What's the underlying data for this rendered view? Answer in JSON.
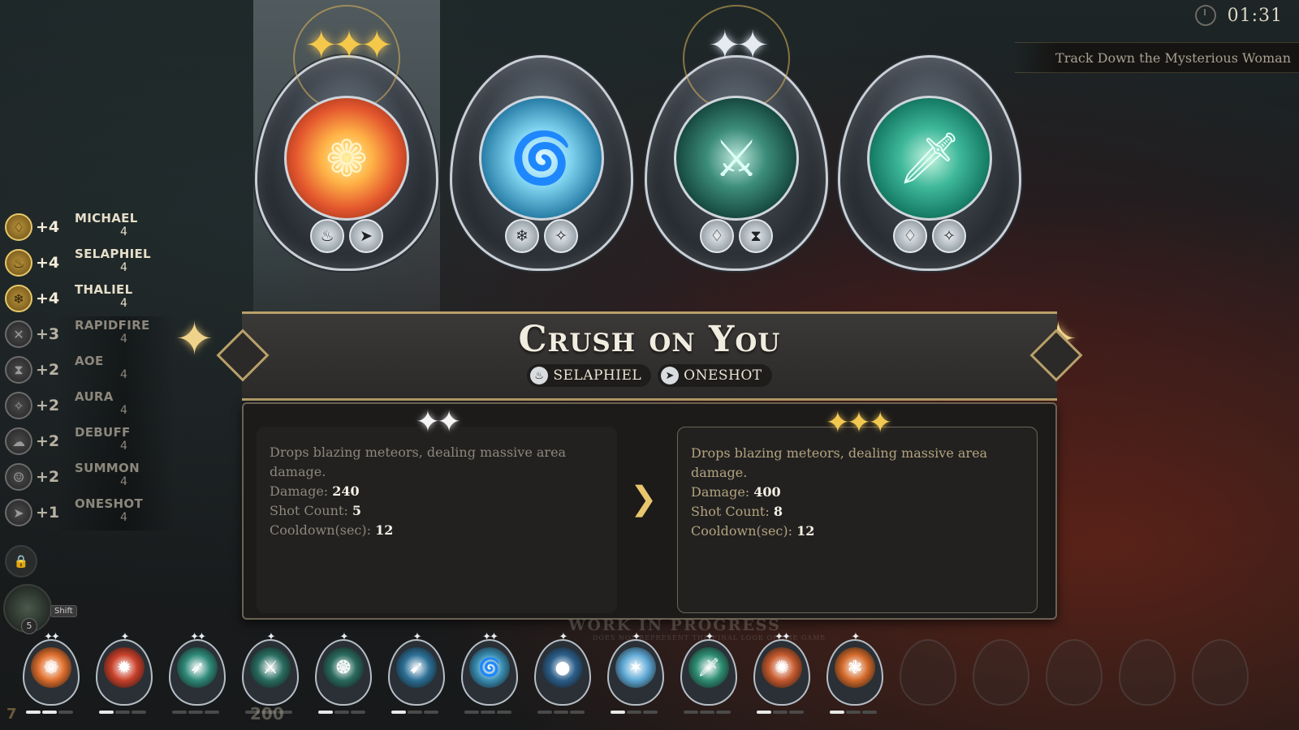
{
  "hud": {
    "timer": "01:31",
    "quest": "Track Down the Mysterious Woman"
  },
  "synergies": [
    {
      "icon": "♢",
      "level": "+4",
      "name": "MICHAEL",
      "count": "4",
      "active": true,
      "icon_name": "sword-icon"
    },
    {
      "icon": "♨",
      "level": "+4",
      "name": "SELAPHIEL",
      "count": "4",
      "active": true,
      "icon_name": "flame-icon"
    },
    {
      "icon": "❄",
      "level": "+4",
      "name": "THALIEL",
      "count": "4",
      "active": true,
      "icon_name": "snowflake-icon"
    },
    {
      "icon": "✕",
      "level": "+3",
      "name": "RAPIDFIRE",
      "count": "4",
      "active": false,
      "icon_name": "rapidfire-icon"
    },
    {
      "icon": "⧗",
      "level": "+2",
      "name": "AOE",
      "count": "4",
      "active": false,
      "icon_name": "hourglass-icon"
    },
    {
      "icon": "✧",
      "level": "+2",
      "name": "AURA",
      "count": "4",
      "active": false,
      "icon_name": "aura-icon"
    },
    {
      "icon": "☁",
      "level": "+2",
      "name": "DEBUFF",
      "count": "4",
      "active": false,
      "icon_name": "debuff-icon"
    },
    {
      "icon": "☺",
      "level": "+2",
      "name": "SUMMON",
      "count": "4",
      "active": false,
      "icon_name": "summon-icon"
    },
    {
      "icon": "➤",
      "level": "+1",
      "name": "ONESHOT",
      "count": "4",
      "active": false,
      "icon_name": "oneshot-icon"
    }
  ],
  "character": {
    "number": "5",
    "shift_key": "Shift",
    "lock_icon": "lock-icon"
  },
  "choices": [
    {
      "name": "crush-on-you",
      "orb_icon": "❁",
      "orb_class": "fire",
      "stars": "✦✦✦",
      "star_color": "gold",
      "tags": [
        "♨",
        "➤"
      ],
      "tag_names": [
        "selaphiel-tag-icon",
        "oneshot-tag-icon"
      ],
      "selected": true
    },
    {
      "name": "tornado",
      "orb_icon": "🌀",
      "orb_class": "ice",
      "stars": "",
      "star_color": "",
      "tags": [
        "❄",
        "✧"
      ],
      "tag_names": [
        "thaliel-tag-icon",
        "aura-tag-icon"
      ],
      "selected": false
    },
    {
      "name": "blade-rain",
      "orb_icon": "⚔",
      "orb_class": "blade",
      "stars": "✦✦",
      "star_color": "silver",
      "tags": [
        "♢",
        "⧗"
      ],
      "tag_names": [
        "michael-tag-icon",
        "aoe-tag-icon"
      ],
      "selected": false
    },
    {
      "name": "sword-wind",
      "orb_icon": "🗡",
      "orb_class": "wind",
      "stars": "",
      "star_color": "",
      "tags": [
        "♢",
        "✧"
      ],
      "tag_names": [
        "michael-tag-icon",
        "aura-tag-icon"
      ],
      "selected": false
    }
  ],
  "detail": {
    "title": "Crush on You",
    "tags": [
      {
        "icon": "♨",
        "label": "SELAPHIEL"
      },
      {
        "icon": "➤",
        "label": "ONESHOT"
      }
    ],
    "before": {
      "stars": "✦✦",
      "description": "Drops blazing meteors, dealing massive area damage.",
      "damage_label": "Damage:",
      "damage": "240",
      "shot_label": "Shot Count:",
      "shot": "5",
      "cooldown_label": "Cooldown(sec):",
      "cooldown": "12"
    },
    "after": {
      "stars": "✦✦✦",
      "description": "Drops blazing meteors, dealing massive area damage.",
      "damage_label": "Damage:",
      "damage": "400",
      "shot_label": "Shot Count:",
      "shot": "8",
      "cooldown_label": "Cooldown(sec):",
      "cooldown": "12"
    }
  },
  "watermark": {
    "title": "WORK IN PROGRESS",
    "subtitle": "DOES NOT REPRESENT THE FINAL LOOK OF THE GAME"
  },
  "inventory": [
    {
      "icon": "❁",
      "color": "#e0702e",
      "stars": "✦✦",
      "pips": 2
    },
    {
      "icon": "✹",
      "color": "#c9402a",
      "stars": "✦",
      "pips": 1
    },
    {
      "icon": "➶",
      "color": "#2f8a7a",
      "stars": "✦✦",
      "pips": 0
    },
    {
      "icon": "⚔",
      "color": "#2a6e62",
      "stars": "✦",
      "pips": 0
    },
    {
      "icon": "❂",
      "color": "#2a6a5e",
      "stars": "✦",
      "pips": 1
    },
    {
      "icon": "➹",
      "color": "#2c6f96",
      "stars": "✦",
      "pips": 1
    },
    {
      "icon": "🌀",
      "color": "#3a8fb5",
      "stars": "✦✦",
      "pips": 0
    },
    {
      "icon": "●",
      "color": "#2c5f8a",
      "stars": "✦",
      "pips": 0
    },
    {
      "icon": "✶",
      "color": "#5fa9d6",
      "stars": "✦",
      "pips": 1
    },
    {
      "icon": "🗡",
      "color": "#2f8f74",
      "stars": "✦",
      "pips": 0
    },
    {
      "icon": "✺",
      "color": "#c65a2e",
      "stars": "✦✦",
      "pips": 1
    },
    {
      "icon": "❃",
      "color": "#d46a2a",
      "stars": "✦",
      "pips": 1
    }
  ],
  "empty_slots": 5,
  "footer": {
    "level": "7",
    "gold": "200"
  }
}
